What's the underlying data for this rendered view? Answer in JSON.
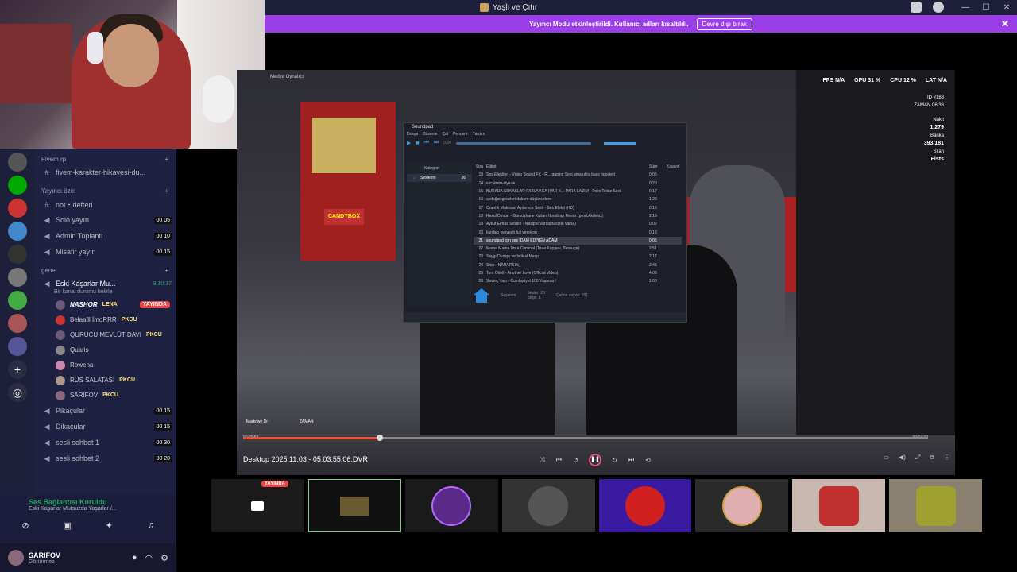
{
  "window": {
    "title": "Yaşlı ve Çıtır"
  },
  "banner": {
    "text": "Yayıncı Modu etkinleştirildi. Kullanıcı adları kısaltıldı.",
    "button": "Devre dışı bırak"
  },
  "sidebar": {
    "categories": [
      {
        "name": "Fivem rp",
        "channels": [
          {
            "name": "fivem-karakter-hikayesi-du..."
          }
        ]
      },
      {
        "name": "Yayıncı özel",
        "channels": [
          {
            "name": "not・defteri"
          },
          {
            "name": "Solo yayın",
            "count": "00 05"
          },
          {
            "name": "Admin Toplantı",
            "count": "00 10"
          },
          {
            "name": "Misafir yayın",
            "count": "00 15"
          }
        ]
      },
      {
        "name": "genel"
      }
    ],
    "active_channel": {
      "name": "Eski Kaşarlar Mu...",
      "time": "9:10:17",
      "status": "Bir kanal durumu belirle"
    },
    "users": [
      {
        "name": "NASHOR",
        "tag": "LENA",
        "live": "YAYINDA"
      },
      {
        "name": "Belaalll İmoRRR",
        "tag": "PKCU"
      },
      {
        "name": "QURUCU MEVLÜT DAVI",
        "tag": "PKCU"
      },
      {
        "name": "Quaris"
      },
      {
        "name": "Rowena"
      },
      {
        "name": "RUS SALATASI",
        "tag": "PKCU"
      },
      {
        "name": "SARIFOV",
        "tag": "PKCU"
      }
    ],
    "more_channels": [
      {
        "name": "Pikaçular",
        "count": "00 15"
      },
      {
        "name": "Dikaçular",
        "count": "00 15"
      },
      {
        "name": "sesli sohbet 1",
        "count": "00 30"
      },
      {
        "name": "sesli sohbet 2",
        "count": "00 20"
      }
    ]
  },
  "voice": {
    "status": "Ses Bağlantısı Kuruldu",
    "channel": "Eski Kaşarlar Mutsuzda Yaşarlar /..."
  },
  "me": {
    "name": "SARIFOV",
    "status": "Görünmez"
  },
  "player": {
    "title": "Medya Oynatıcı",
    "filename": "Desktop 2025.11.03 - 05.03.55.06.DVR",
    "time_elapsed": "00:00:58",
    "time_total": "00:04:02",
    "progress": 0.2,
    "hud": {
      "fps": "FPS N/A",
      "gpu": "GPU 31 %",
      "cpu": "CPU 12 %",
      "lat": "LAT N/A"
    },
    "side": {
      "id": "ID #188",
      "zaman": "ZAMAN 06:36",
      "nakit_label": "Nakit",
      "nakit": "1.279",
      "banka_label": "Banka",
      "banka": "393.181",
      "silah_label": "Silah",
      "silah": "Fists"
    },
    "bottom_hud": {
      "left": "Markowe Dr",
      "right": "ZAMAN"
    }
  },
  "soundpad": {
    "title": "Soundpad",
    "menu": [
      "Dosya",
      "Düzenle",
      "Çal",
      "Pencere",
      "Yardım"
    ],
    "time": "0:00",
    "category": "Seslerim",
    "category_count": "26",
    "headers": [
      "Kategori",
      "#",
      "Sıra",
      "Etiket",
      "Süre",
      "Kısayol"
    ],
    "rows": [
      {
        "n": "13",
        "t": "Ses Efektleri - Video Sound FX - R... gaging Sesi ama ultra bass boosted",
        "d": "0:05"
      },
      {
        "n": "14",
        "t": "ezc-kuzu-ciye-te",
        "d": "0:20"
      },
      {
        "n": "15",
        "t": "BURADA SOKAKLAR FAZLA ACA (VAR K... PARA LAZIM - Polis Telsiz Sesi",
        "d": "0:17"
      },
      {
        "n": "16",
        "t": "aydoğar geceleri daldım düşüncelere",
        "d": "1:29"
      },
      {
        "n": "17",
        "t": "Orantılı Makinası Aydemce Sesli - Ses Efekti (HD)",
        "d": "0:16"
      },
      {
        "n": "18",
        "t": "Resul Dindar - Gümüşhane Kızları Hoodtrap Remix (prod.Akdeniz)",
        "d": "2:19"
      },
      {
        "n": "19",
        "t": "Aykut Elmas Sesleri - Nasipte Varsa(nasipte varsa)",
        "d": "0:02"
      },
      {
        "n": "20",
        "t": "kurdacı yeliyeah full versiyon",
        "d": "0:18"
      },
      {
        "n": "21",
        "t": "soundpad için ses İDAM EDİYEN ADAM",
        "d": "0:05"
      },
      {
        "n": "22",
        "t": "Mama Mama I'm a Criminal (Тони Харден, Легенда)",
        "d": "2:51"
      },
      {
        "n": "23",
        "t": "Saygı Duruşu ve İstiklal Marşı",
        "d": "2:17"
      },
      {
        "n": "24",
        "t": "Stop - NARARSIN_",
        "d": "2:45"
      },
      {
        "n": "25",
        "t": "Tom Odell - Another Love (Official Video)",
        "d": "4:08"
      },
      {
        "n": "26",
        "t": "Sevinç Yaşı - Cumhuriyet 100 Yaşında !",
        "d": "1:00"
      }
    ],
    "footer": {
      "sesler_label": "Sesler:",
      "sesler": "26",
      "secili_label": "Seçili:",
      "secili": "1",
      "calma_label": "Çalma sayısı:",
      "calma": "181"
    }
  },
  "streams": {
    "live_label": "YAYINDA"
  }
}
